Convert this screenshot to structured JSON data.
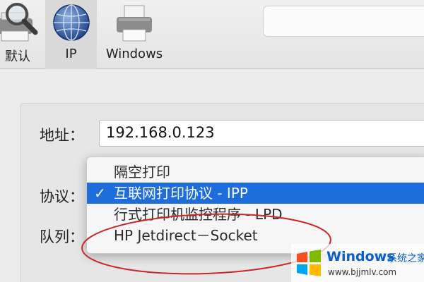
{
  "toolbar": {
    "items": [
      {
        "label": "默认",
        "icon": "magnifier-printer-icon"
      },
      {
        "label": "IP",
        "icon": "globe-icon",
        "selected": true
      },
      {
        "label": "Windows",
        "icon": "printer-icon"
      }
    ],
    "search_value": ""
  },
  "form": {
    "address_label": "地址：",
    "address_value": "192.168.0.123",
    "protocol_label": "协议：",
    "queue_label": "队列："
  },
  "protocol_menu": {
    "items": [
      {
        "label": "隔空打印",
        "selected": false
      },
      {
        "label": "互联网打印协议 - IPP",
        "selected": true
      },
      {
        "label": "行式打印机监控程序 - LPD",
        "selected": false
      },
      {
        "label": "HP Jetdirect－Socket",
        "selected": false
      }
    ],
    "check_glyph": "✓",
    "selection_color": "#1d6ddd"
  },
  "annotation": {
    "color": "#c8282a",
    "target": "HP Jetdirect－Socket"
  },
  "watermark": {
    "brand": "Windows",
    "brand_suffix": "系统之家",
    "url": "www.bjjmlv.com"
  }
}
